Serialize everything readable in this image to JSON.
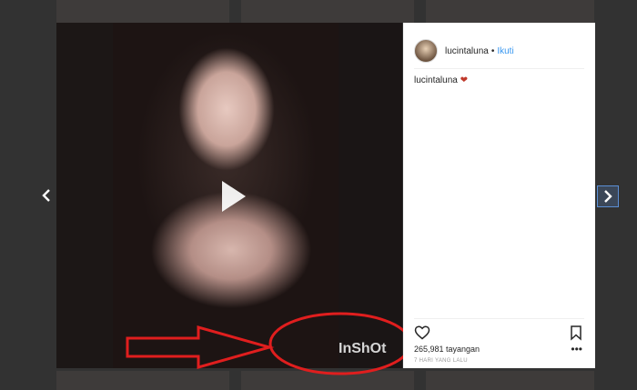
{
  "post": {
    "username": "lucintaluna",
    "separator": "•",
    "follow_label": "Ikuti",
    "caption_user": "lucintaluna",
    "caption_emoji": "❤",
    "views": "265,981 tayangan",
    "date": "7 HARI YANG LALU",
    "more_label": "•••"
  },
  "media": {
    "watermark": "InShOt"
  },
  "colors": {
    "accent_link": "#3897f0",
    "annotation_red": "#e01e1e",
    "panel_bg": "#ffffff",
    "backdrop": "#6f6f6f"
  },
  "icons": {
    "play": "play-icon",
    "heart": "heart-icon",
    "bookmark": "bookmark-icon",
    "prev": "chevron-left-icon",
    "next": "chevron-right-icon"
  }
}
